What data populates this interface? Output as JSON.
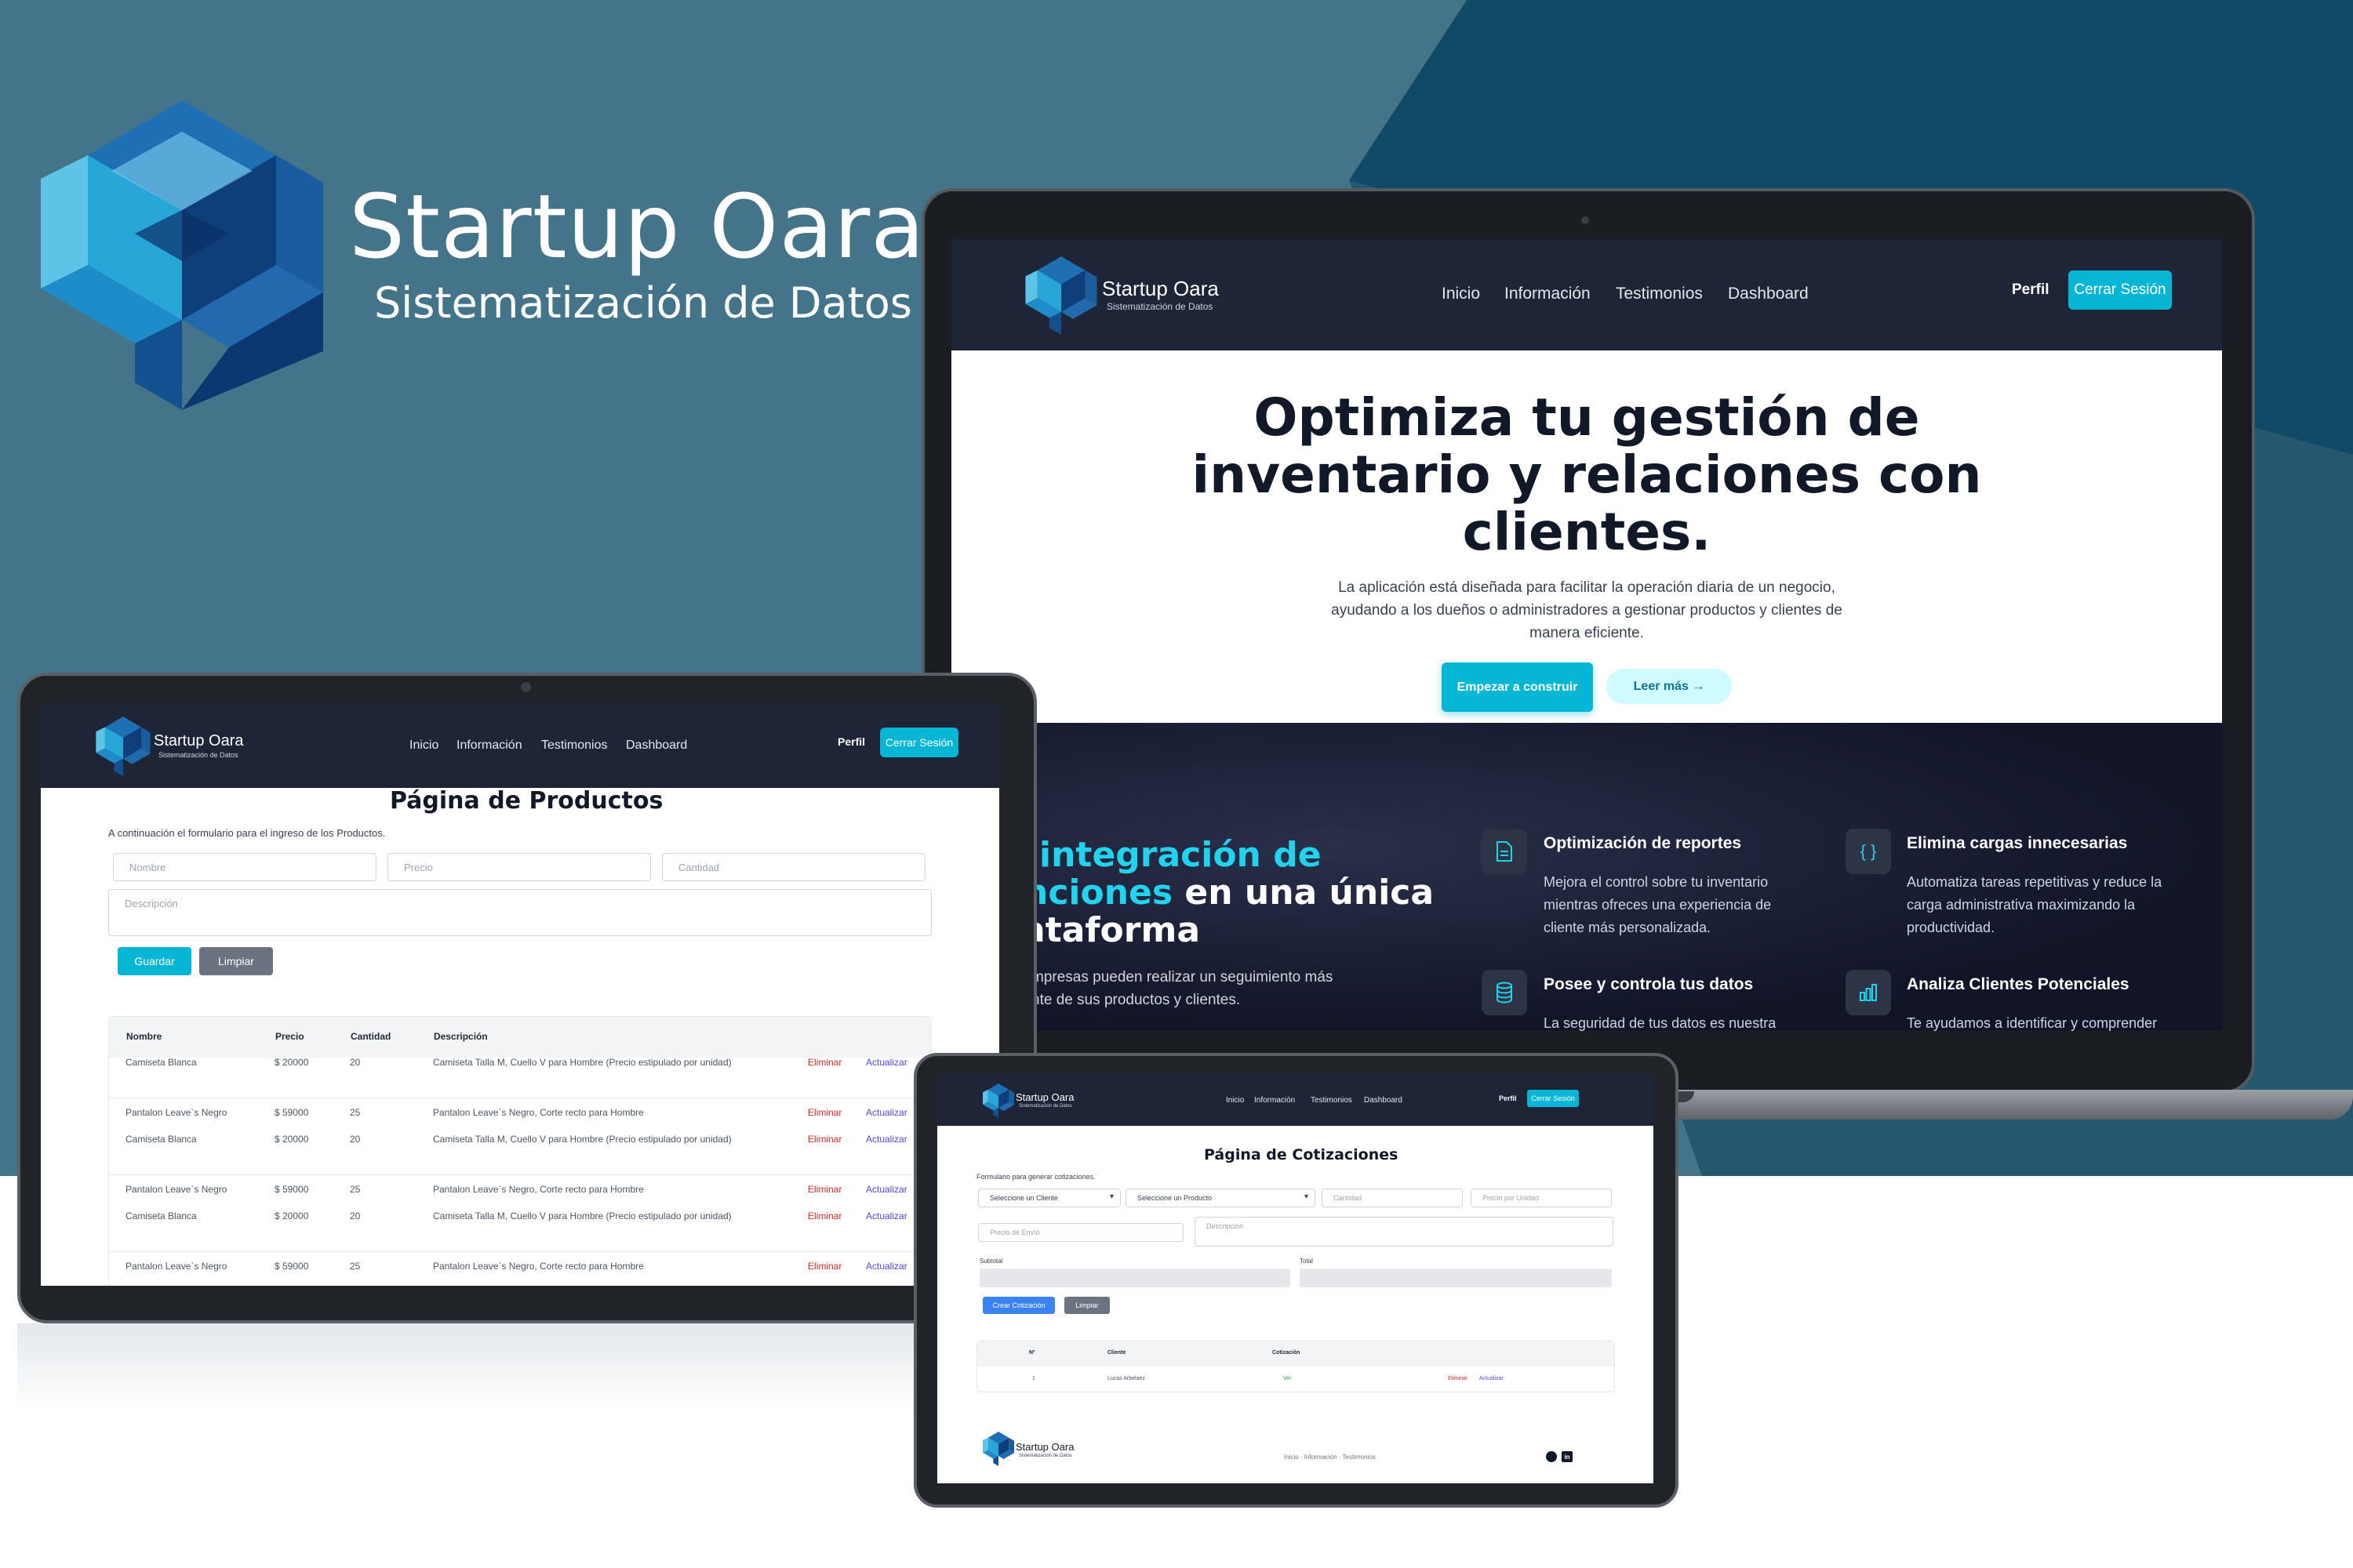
{
  "brand": {
    "title": "Startup Oara",
    "subtitle": "Sistematización de Datos"
  },
  "colors": {
    "background": "#447489",
    "navbar": "#1e2536",
    "accent": "#06b6d4",
    "danger": "#dc2626",
    "link": "#4f46e5"
  },
  "nav": {
    "logo_title": "Startup Oara",
    "logo_subtitle": "Sistematización de Datos",
    "links": [
      "Inicio",
      "Información",
      "Testimonios",
      "Dashboard"
    ],
    "perfil": "Perfil",
    "logout": "Cerrar Sesión"
  },
  "hero": {
    "title_line1": "Optimiza tu gestión de",
    "title_line2": "inventario y relaciones con",
    "title_line3": "clientes.",
    "desc_line1": "La aplicación está diseñada para facilitar la operación diaria de un negocio,",
    "desc_line2": "ayudando a los dueños o administradores a gestionar productos y clientes de",
    "desc_line3": "manera eficiente.",
    "primary_button": "Empezar a construir",
    "secondary_button": "Leer más →"
  },
  "features": {
    "heading_line1": "integración de",
    "heading_line2_cyan": "nciones",
    "heading_line2_rest": " en una única",
    "heading_line3": "ataforma",
    "text_line1": "mpresas pueden realizar un seguimiento más",
    "text_line2": "nte de sus productos y clientes.",
    "items": [
      {
        "icon": "document-icon",
        "title": "Optimización de reportes",
        "desc": "Mejora el control sobre tu inventario mientras ofreces una experiencia de cliente más personalizada."
      },
      {
        "icon": "code-braces-icon",
        "title": "Elimina cargas innecesarias",
        "desc": "Automatiza tareas repetitivas y reduce la carga administrativa maximizando la productividad."
      },
      {
        "icon": "database-icon",
        "title": "Posee y controla tus datos",
        "desc": "La seguridad de tus datos es nuestra"
      },
      {
        "icon": "bar-chart-icon",
        "title": "Analiza Clientes Potenciales",
        "desc": "Te ayudamos a identificar y comprender"
      }
    ]
  },
  "products_page": {
    "title": "Página de Productos",
    "intro": "A continuación el formulario para el ingreso de los Productos.",
    "placeholders": {
      "nombre": "Nombre",
      "precio": "Precio",
      "cantidad": "Cantidad",
      "descripcion": "Descripción"
    },
    "save_button": "Guardar",
    "clear_button": "Limpiar",
    "columns": [
      "Nombre",
      "Precio",
      "Cantidad",
      "Descripción"
    ],
    "delete_label": "Eliminar",
    "update_label": "Actualizar",
    "rows": [
      {
        "nombre": "Camiseta Blanca",
        "precio": "$ 20000",
        "cantidad": "20",
        "descripcion": "Camiseta Talla M, Cuello V para Hombre (Precio estipulado por unidad)"
      },
      {
        "nombre": "Pantalon Leave`s Negro",
        "precio": "$ 59000",
        "cantidad": "25",
        "descripcion": "Pantalon Leave`s Negro, Corte recto para Hombre"
      },
      {
        "nombre": "Camiseta Blanca",
        "precio": "$ 20000",
        "cantidad": "20",
        "descripcion": "Camiseta Talla M, Cuello V para Hombre (Precio estipulado por unidad)"
      },
      {
        "nombre": "Pantalon Leave`s Negro",
        "precio": "$ 59000",
        "cantidad": "25",
        "descripcion": "Pantalon Leave`s Negro, Corte recto para Hombre"
      },
      {
        "nombre": "Camiseta Blanca",
        "precio": "$ 20000",
        "cantidad": "20",
        "descripcion": "Camiseta Talla M, Cuello V para Hombre (Precio estipulado por unidad)"
      },
      {
        "nombre": "Pantalon Leave`s Negro",
        "precio": "$ 59000",
        "cantidad": "25",
        "descripcion": "Pantalon Leave`s Negro, Corte recto para Hombre"
      }
    ]
  },
  "quotes_page": {
    "title": "Página de Cotizaciones",
    "intro": "Formulario para generar cotizaciones.",
    "select_client": "Seleccione un Cliente",
    "select_product": "Seleccione un Producto",
    "cantidad": "Cantidad",
    "precio_unidad": "Precio por Unidad",
    "precio_envio": "Precio de Envío",
    "descripcion": "Descripción",
    "subtotal": "Subtotal",
    "total": "Total",
    "create_button": "Crear Cotización",
    "clear_button": "Limpiar",
    "columns": [
      "Nº",
      "Cliente",
      "Cotización"
    ],
    "row": {
      "num": "1",
      "cliente": "Lucas Arbelaez",
      "cotizacion": "Ver",
      "delete": "Eliminar",
      "update": "Actualizar"
    },
    "footer_links": "Inicio · Información · Testimonios"
  }
}
